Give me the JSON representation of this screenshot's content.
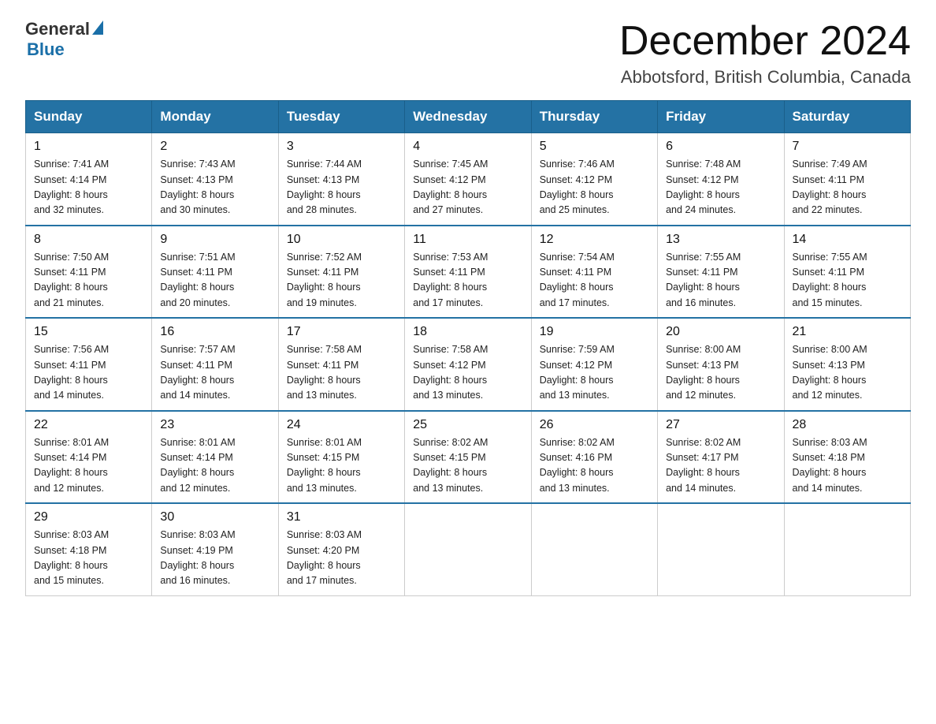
{
  "header": {
    "logo_general": "General",
    "logo_blue": "Blue",
    "month_title": "December 2024",
    "location": "Abbotsford, British Columbia, Canada"
  },
  "days_of_week": [
    "Sunday",
    "Monday",
    "Tuesday",
    "Wednesday",
    "Thursday",
    "Friday",
    "Saturday"
  ],
  "weeks": [
    [
      {
        "day": "1",
        "sunrise": "7:41 AM",
        "sunset": "4:14 PM",
        "daylight": "8 hours and 32 minutes."
      },
      {
        "day": "2",
        "sunrise": "7:43 AM",
        "sunset": "4:13 PM",
        "daylight": "8 hours and 30 minutes."
      },
      {
        "day": "3",
        "sunrise": "7:44 AM",
        "sunset": "4:13 PM",
        "daylight": "8 hours and 28 minutes."
      },
      {
        "day": "4",
        "sunrise": "7:45 AM",
        "sunset": "4:12 PM",
        "daylight": "8 hours and 27 minutes."
      },
      {
        "day": "5",
        "sunrise": "7:46 AM",
        "sunset": "4:12 PM",
        "daylight": "8 hours and 25 minutes."
      },
      {
        "day": "6",
        "sunrise": "7:48 AM",
        "sunset": "4:12 PM",
        "daylight": "8 hours and 24 minutes."
      },
      {
        "day": "7",
        "sunrise": "7:49 AM",
        "sunset": "4:11 PM",
        "daylight": "8 hours and 22 minutes."
      }
    ],
    [
      {
        "day": "8",
        "sunrise": "7:50 AM",
        "sunset": "4:11 PM",
        "daylight": "8 hours and 21 minutes."
      },
      {
        "day": "9",
        "sunrise": "7:51 AM",
        "sunset": "4:11 PM",
        "daylight": "8 hours and 20 minutes."
      },
      {
        "day": "10",
        "sunrise": "7:52 AM",
        "sunset": "4:11 PM",
        "daylight": "8 hours and 19 minutes."
      },
      {
        "day": "11",
        "sunrise": "7:53 AM",
        "sunset": "4:11 PM",
        "daylight": "8 hours and 17 minutes."
      },
      {
        "day": "12",
        "sunrise": "7:54 AM",
        "sunset": "4:11 PM",
        "daylight": "8 hours and 17 minutes."
      },
      {
        "day": "13",
        "sunrise": "7:55 AM",
        "sunset": "4:11 PM",
        "daylight": "8 hours and 16 minutes."
      },
      {
        "day": "14",
        "sunrise": "7:55 AM",
        "sunset": "4:11 PM",
        "daylight": "8 hours and 15 minutes."
      }
    ],
    [
      {
        "day": "15",
        "sunrise": "7:56 AM",
        "sunset": "4:11 PM",
        "daylight": "8 hours and 14 minutes."
      },
      {
        "day": "16",
        "sunrise": "7:57 AM",
        "sunset": "4:11 PM",
        "daylight": "8 hours and 14 minutes."
      },
      {
        "day": "17",
        "sunrise": "7:58 AM",
        "sunset": "4:11 PM",
        "daylight": "8 hours and 13 minutes."
      },
      {
        "day": "18",
        "sunrise": "7:58 AM",
        "sunset": "4:12 PM",
        "daylight": "8 hours and 13 minutes."
      },
      {
        "day": "19",
        "sunrise": "7:59 AM",
        "sunset": "4:12 PM",
        "daylight": "8 hours and 13 minutes."
      },
      {
        "day": "20",
        "sunrise": "8:00 AM",
        "sunset": "4:13 PM",
        "daylight": "8 hours and 12 minutes."
      },
      {
        "day": "21",
        "sunrise": "8:00 AM",
        "sunset": "4:13 PM",
        "daylight": "8 hours and 12 minutes."
      }
    ],
    [
      {
        "day": "22",
        "sunrise": "8:01 AM",
        "sunset": "4:14 PM",
        "daylight": "8 hours and 12 minutes."
      },
      {
        "day": "23",
        "sunrise": "8:01 AM",
        "sunset": "4:14 PM",
        "daylight": "8 hours and 12 minutes."
      },
      {
        "day": "24",
        "sunrise": "8:01 AM",
        "sunset": "4:15 PM",
        "daylight": "8 hours and 13 minutes."
      },
      {
        "day": "25",
        "sunrise": "8:02 AM",
        "sunset": "4:15 PM",
        "daylight": "8 hours and 13 minutes."
      },
      {
        "day": "26",
        "sunrise": "8:02 AM",
        "sunset": "4:16 PM",
        "daylight": "8 hours and 13 minutes."
      },
      {
        "day": "27",
        "sunrise": "8:02 AM",
        "sunset": "4:17 PM",
        "daylight": "8 hours and 14 minutes."
      },
      {
        "day": "28",
        "sunrise": "8:03 AM",
        "sunset": "4:18 PM",
        "daylight": "8 hours and 14 minutes."
      }
    ],
    [
      {
        "day": "29",
        "sunrise": "8:03 AM",
        "sunset": "4:18 PM",
        "daylight": "8 hours and 15 minutes."
      },
      {
        "day": "30",
        "sunrise": "8:03 AM",
        "sunset": "4:19 PM",
        "daylight": "8 hours and 16 minutes."
      },
      {
        "day": "31",
        "sunrise": "8:03 AM",
        "sunset": "4:20 PM",
        "daylight": "8 hours and 17 minutes."
      },
      null,
      null,
      null,
      null
    ]
  ],
  "labels": {
    "sunrise": "Sunrise:",
    "sunset": "Sunset:",
    "daylight": "Daylight:"
  }
}
